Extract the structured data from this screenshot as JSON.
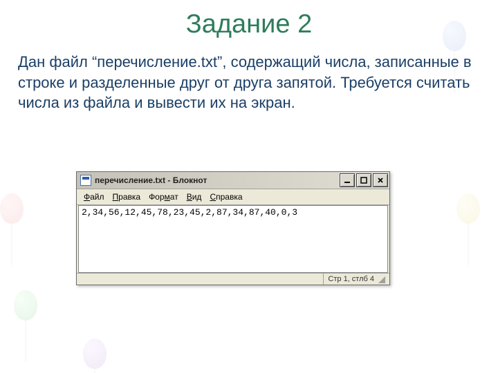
{
  "slide": {
    "title": "Задание 2",
    "body": "Дан файл “перечисление.txt”, содержащий числа, записанные в строке и разделенные друг от друга запятой. Требуется считать числа из файла и вывести их на экран."
  },
  "notepad": {
    "window_title": "перечисление.txt - Блокнот",
    "menus": {
      "file": {
        "pre": "",
        "hot": "Ф",
        "post": "айл"
      },
      "edit": {
        "pre": "",
        "hot": "П",
        "post": "равка"
      },
      "format": {
        "pre": "Фор",
        "hot": "м",
        "post": "ат"
      },
      "view": {
        "pre": "",
        "hot": "В",
        "post": "ид"
      },
      "help": {
        "pre": "",
        "hot": "С",
        "post": "правка"
      }
    },
    "content": "2,34,56,12,45,78,23,45,2,87,34,87,40,0,3",
    "status": "Стр 1, стлб 4"
  }
}
